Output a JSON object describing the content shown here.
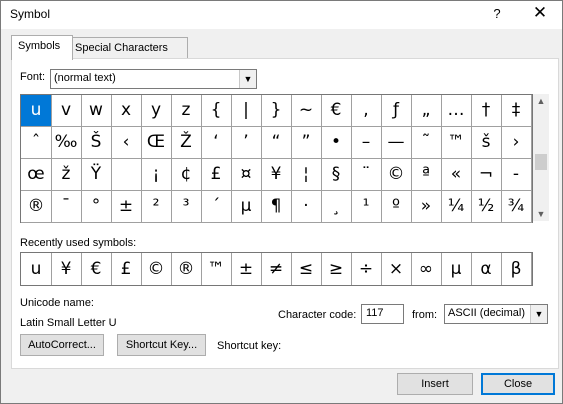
{
  "window": {
    "title": "Symbol",
    "help_glyph": "?",
    "close_glyph": "✕"
  },
  "tabs": [
    {
      "label": "Symbols",
      "active": true
    },
    {
      "label": "Special Characters",
      "active": false
    }
  ],
  "font": {
    "label": "Font:",
    "value": "(normal text)"
  },
  "grid": {
    "rows": [
      [
        "u",
        "v",
        "w",
        "x",
        "y",
        "z",
        "{",
        "|",
        "}",
        "~",
        "€",
        ",",
        "ƒ",
        "„",
        "…",
        "†",
        "‡"
      ],
      [
        "ˆ",
        "‰",
        "Š",
        "‹",
        "Œ",
        "Ž",
        "‘",
        "’",
        "“",
        "”",
        "•",
        "–",
        "—",
        "˜",
        "™",
        "š",
        "›"
      ],
      [
        "œ",
        "ž",
        "Ÿ",
        "",
        "¡",
        "¢",
        "£",
        "¤",
        "¥",
        "¦",
        "§",
        "¨",
        "©",
        "ª",
        "«",
        "¬",
        "-"
      ],
      [
        "®",
        "¯",
        "°",
        "±",
        "²",
        "³",
        "´",
        "µ",
        "¶",
        "·",
        "¸",
        "¹",
        "º",
        "»",
        "¼",
        "½",
        "¾"
      ]
    ],
    "selected": "u"
  },
  "recent": {
    "label": "Recently used symbols:",
    "symbols": [
      "u",
      "¥",
      "€",
      "£",
      "©",
      "®",
      "™",
      "±",
      "≠",
      "≤",
      "≥",
      "÷",
      "×",
      "∞",
      "µ",
      "α",
      "β"
    ]
  },
  "unicode": {
    "label": "Unicode name:",
    "value": "Latin Small Letter U"
  },
  "char_code": {
    "label": "Character code:",
    "value": "117"
  },
  "from": {
    "label": "from:",
    "value": "ASCII (decimal)"
  },
  "buttons": {
    "autocorrect": "AutoCorrect...",
    "shortcut_key_button": "Shortcut Key...",
    "shortcut_key_label": "Shortcut key:",
    "insert": "Insert",
    "close": "Close"
  },
  "colors": {
    "selection": "#0078d7",
    "dialog_bg": "#f0f0f0"
  }
}
